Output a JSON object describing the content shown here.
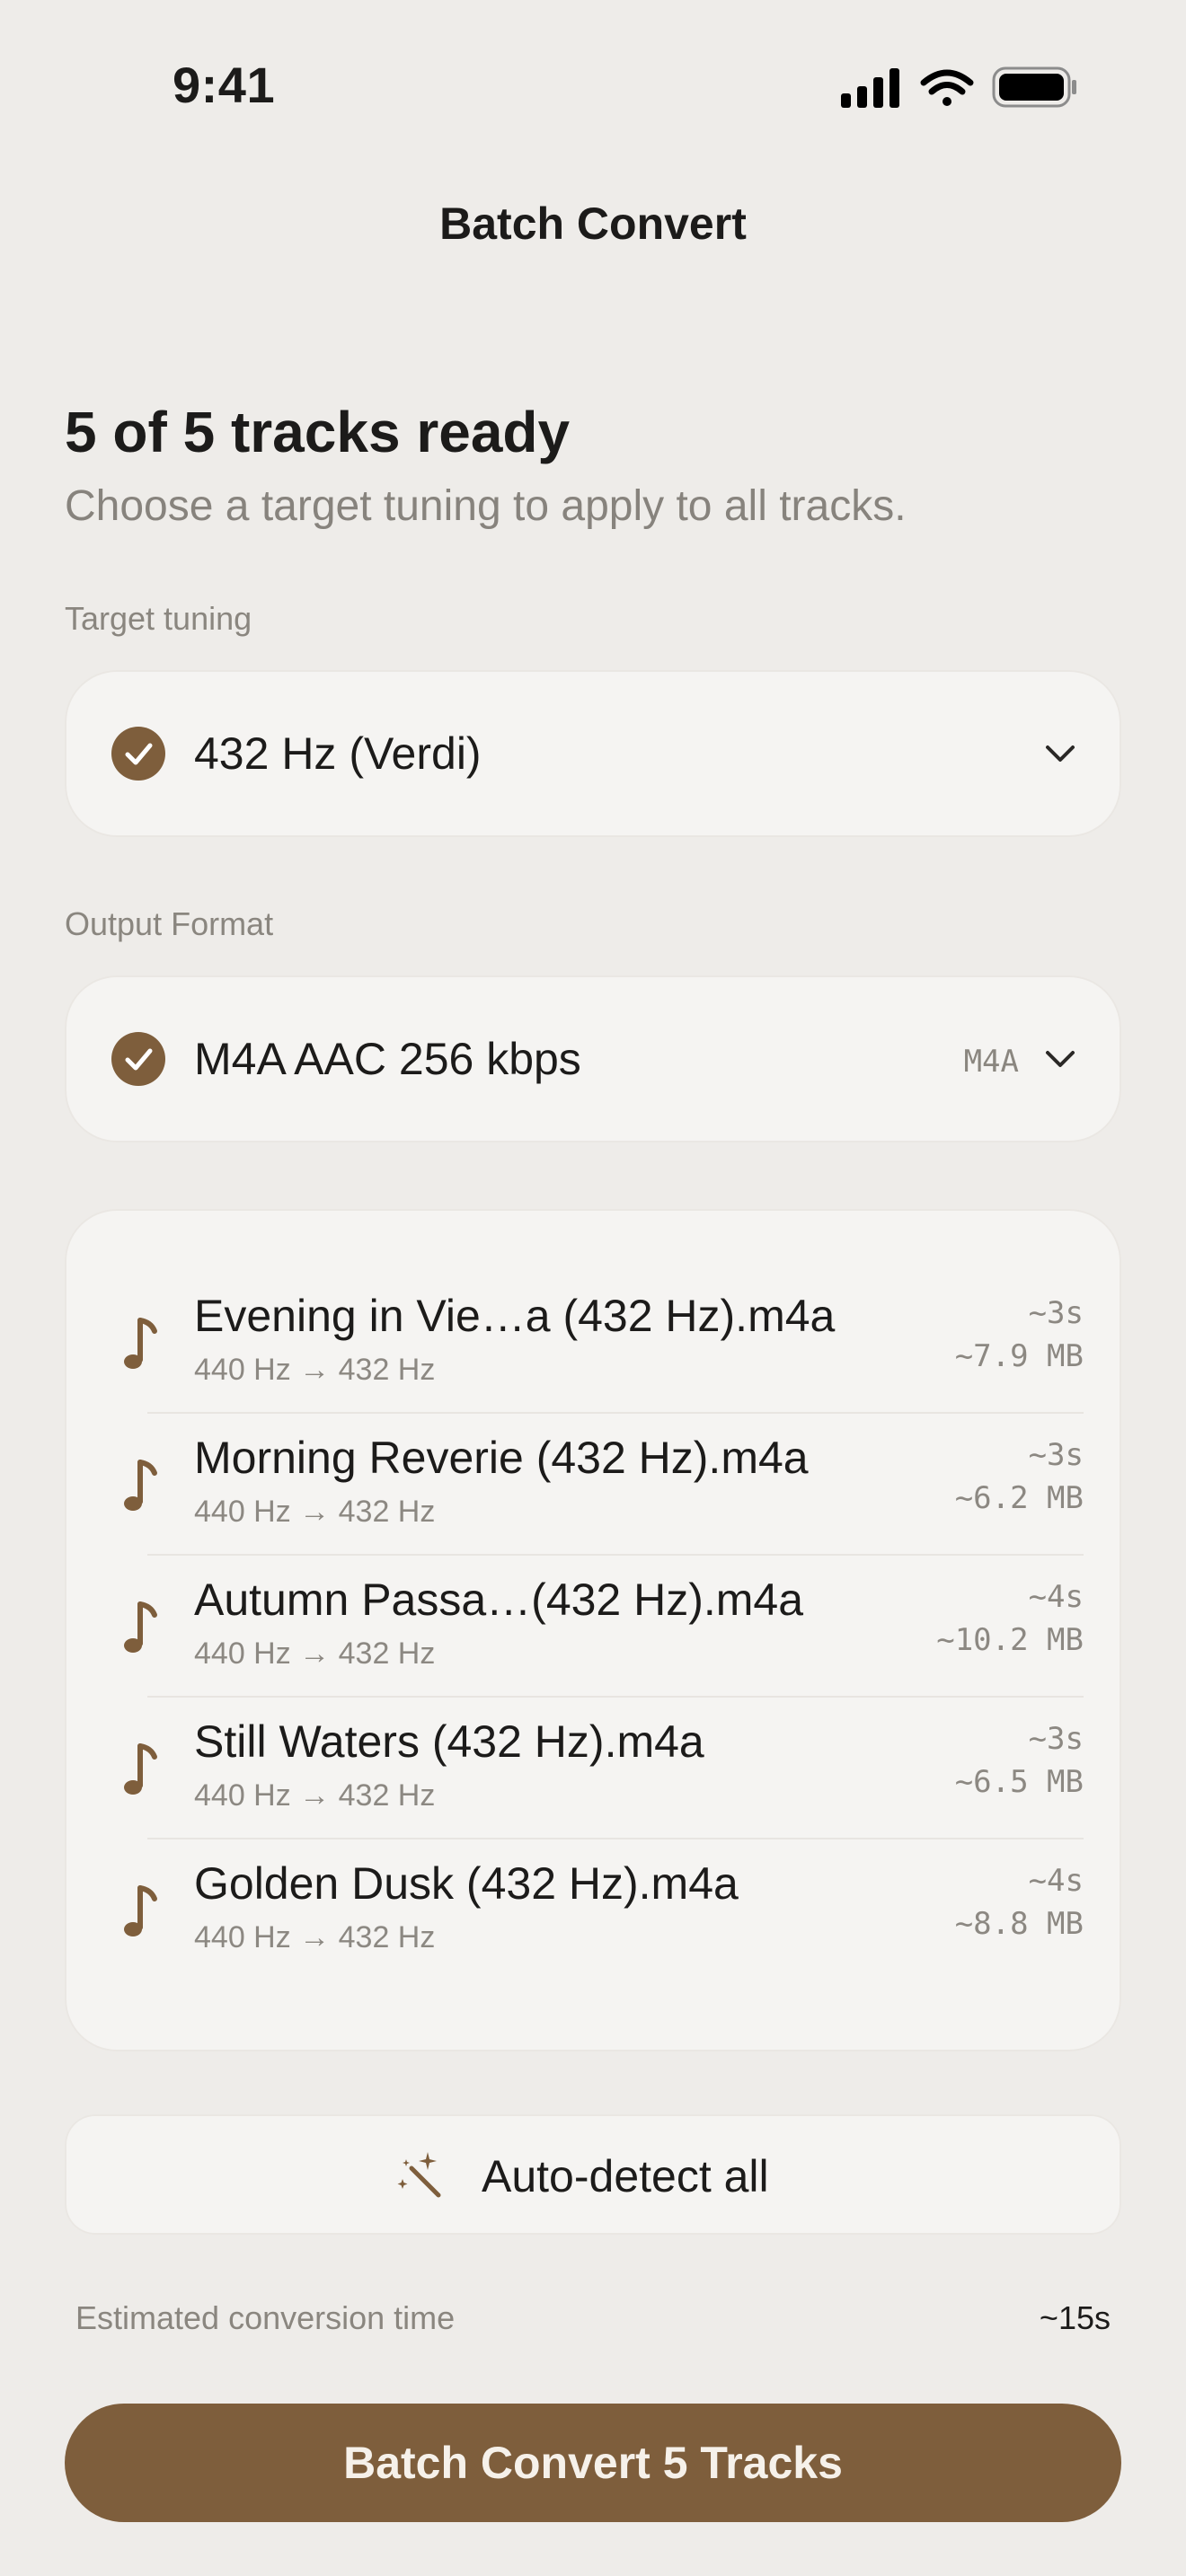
{
  "status_bar": {
    "time": "9:41"
  },
  "nav": {
    "title": "Batch Convert"
  },
  "header": {
    "headline": "5 of 5 tracks ready",
    "subhead": "Choose a target tuning to apply to all tracks."
  },
  "target_tuning": {
    "label": "Target tuning",
    "selected": "432 Hz (Verdi)"
  },
  "output_format": {
    "label": "Output Format",
    "selected": "M4A AAC 256 kbps",
    "tag": "M4A"
  },
  "tracks": [
    {
      "title": "Evening in Vie…a (432 Hz).m4a",
      "conversion": "440 Hz → 432 Hz",
      "time": "~3s",
      "size": "~7.9 MB"
    },
    {
      "title": "Morning Reverie (432 Hz).m4a",
      "conversion": "440 Hz → 432 Hz",
      "time": "~3s",
      "size": "~6.2 MB"
    },
    {
      "title": "Autumn Passa…(432 Hz).m4a",
      "conversion": "440 Hz → 432 Hz",
      "time": "~4s",
      "size": "~10.2 MB"
    },
    {
      "title": "Still Waters (432 Hz).m4a",
      "conversion": "440 Hz → 432 Hz",
      "time": "~3s",
      "size": "~6.5 MB"
    },
    {
      "title": "Golden Dusk (432 Hz).m4a",
      "conversion": "440 Hz → 432 Hz",
      "time": "~4s",
      "size": "~8.8 MB"
    }
  ],
  "auto_detect": {
    "label": "Auto-detect all",
    "icon": "magic-wand-icon"
  },
  "estimate": {
    "label": "Estimated conversion time",
    "value": "~15s"
  },
  "primary_action": {
    "label": "Batch Convert 5 Tracks"
  },
  "colors": {
    "accent": "#7E5E3C",
    "background": "#EEECE9",
    "card": "#F5F4F2"
  }
}
